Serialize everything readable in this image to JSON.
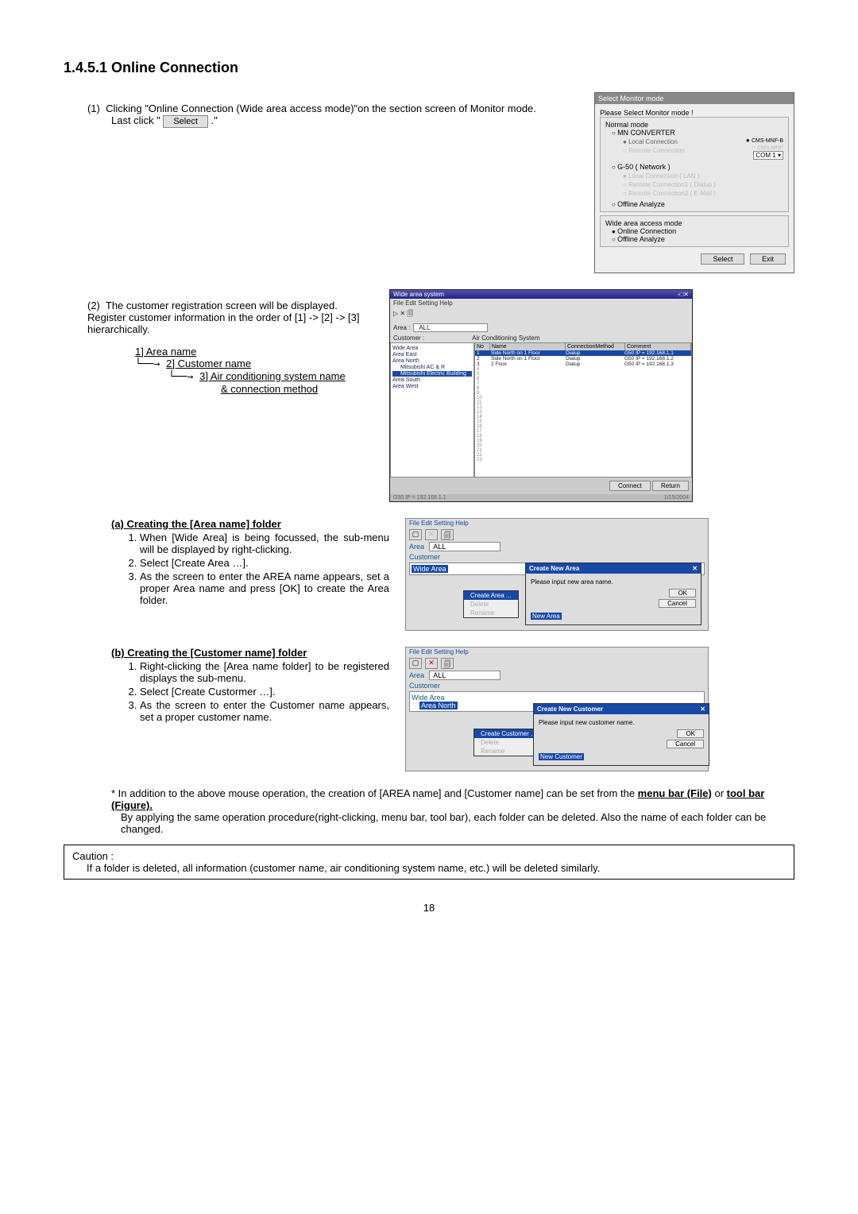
{
  "heading": "1.4.5.1 Online Connection",
  "page_number": "18",
  "step1": {
    "num": "(1)",
    "text_a": "Clicking \"Online Connection (Wide area access mode)\"on the section screen of Monitor mode.",
    "text_b": "Last click \"",
    "text_c": ".\"",
    "button_label": "Select"
  },
  "dialog1": {
    "title": "Select Monitor mode",
    "prompt": "Please Select Monitor mode !",
    "group1": "Normal mode",
    "opt_mn": "MN CONVERTER",
    "opt_local_conn": "Local Connection",
    "opt_remote_conn": "Remote Connection",
    "right1": "CMS-MNF-B",
    "right2": "CMS-MNF",
    "combo": "COM 1",
    "opt_g50": "G-50 ( Network )",
    "g50_a": "Local Connection   ( LAN )",
    "g50_b": "Remote Connection1 ( Dialup )",
    "g50_c": "Remote Connection2 ( E-Mail )",
    "opt_offline1": "Offline Analyze",
    "group2": "Wide area access mode",
    "opt_online": "Online Connection",
    "opt_offline2": "Offline Analyze",
    "btn_select": "Select",
    "btn_exit": "Exit"
  },
  "step2": {
    "num": "(2)",
    "text": "The customer registration screen will be displayed. Register customer information in the order of [1] -> [2] -> [3] hierarchically.",
    "tree1": "1] Area name",
    "tree2": "2] Customer name",
    "tree3": "3] Air conditioning system name",
    "tree4": "& connection method"
  },
  "dialog2": {
    "title": "Wide area system",
    "menu": "File  Edit  Setting  Help",
    "area_label": "Area :",
    "area_value": "ALL",
    "customer_label": "Customer :",
    "ac_label": "Air Conditioning System",
    "tree": [
      "Wide Area",
      "  Area East",
      "  Area North",
      "    Mitsubishi AC & R",
      "    Mitsubishi Electric Building",
      "  Area South",
      "  Area West"
    ],
    "cols": [
      "No",
      "Name",
      "ConnectionMethod",
      "Comment"
    ],
    "rows": [
      [
        "1",
        "Side North on 1 Floor",
        "Dialup",
        "G50 IP = 192.168.1.1"
      ],
      [
        "2",
        "Side North on 1 Floor",
        "Dialup",
        "G50 IP = 192.168.1.2"
      ],
      [
        "3",
        "2 Floor",
        "Dialup",
        "G50 IP = 192.168.1.3"
      ]
    ],
    "status": "G50 IP = 192.168.1.1",
    "date": "1/15/2004",
    "btn_connect": "Connect",
    "btn_return": "Return"
  },
  "section_a": {
    "title": "(a) Creating the [Area name] folder",
    "item1": "When [Wide Area] is being focussed, the sub-menu will be displayed by right-clicking.",
    "item2": "Select [Create Area …].",
    "item3": "As the screen to enter the AREA name appears, set a proper Area name and press [OK] to create the Area folder."
  },
  "mini_a": {
    "menu": "File  Edit  Setting  Help",
    "area": "Area",
    "area_val": "ALL",
    "customer": "Customer",
    "wide_area": "Wide Area",
    "ctx_hi": "Create Area ...",
    "ctx_a": "Delete",
    "ctx_b": "Rename",
    "popup_title": "Create New Area",
    "popup_msg": "Please input new area name.",
    "popup_val": "New Area",
    "ok": "OK",
    "cancel": "Cancel"
  },
  "section_b": {
    "title": "(b) Creating the [Customer name] folder",
    "item1": "Right-clicking the [Area name folder] to be registered displays the sub-menu.",
    "item2": "Select [Create Custormer …].",
    "item3": "As the screen to enter the Customer name appears, set a proper customer name."
  },
  "mini_b": {
    "menu": "File  Edit  Setting  Help",
    "area": "Area",
    "area_val": "ALL",
    "customer": "Customer",
    "wide_area": "Wide Area",
    "area_north": "Area North",
    "ctx_hi": "Create Customer ...",
    "ctx_a": "Delete",
    "ctx_b": "Rename",
    "popup_title": "Create New Customer",
    "popup_msg": "Please input new customer name.",
    "popup_val": "New Customer",
    "ok": "OK",
    "cancel": "Cancel"
  },
  "footnote": {
    "line1a": "* In addition to the above mouse operation, the creation of [AREA name] and [Customer name] can be set from the ",
    "line1b": "menu bar (File)",
    "line1c": " or ",
    "line1d": "tool bar (Figure).",
    "line2": "By applying the same operation procedure(right-clicking, menu bar, tool bar), each folder can be deleted. Also the name of each folder can be changed."
  },
  "caution": {
    "label": "Caution :",
    "text": "If a folder is deleted, all information (customer name, air conditioning system name, etc.) will be deleted similarly."
  }
}
